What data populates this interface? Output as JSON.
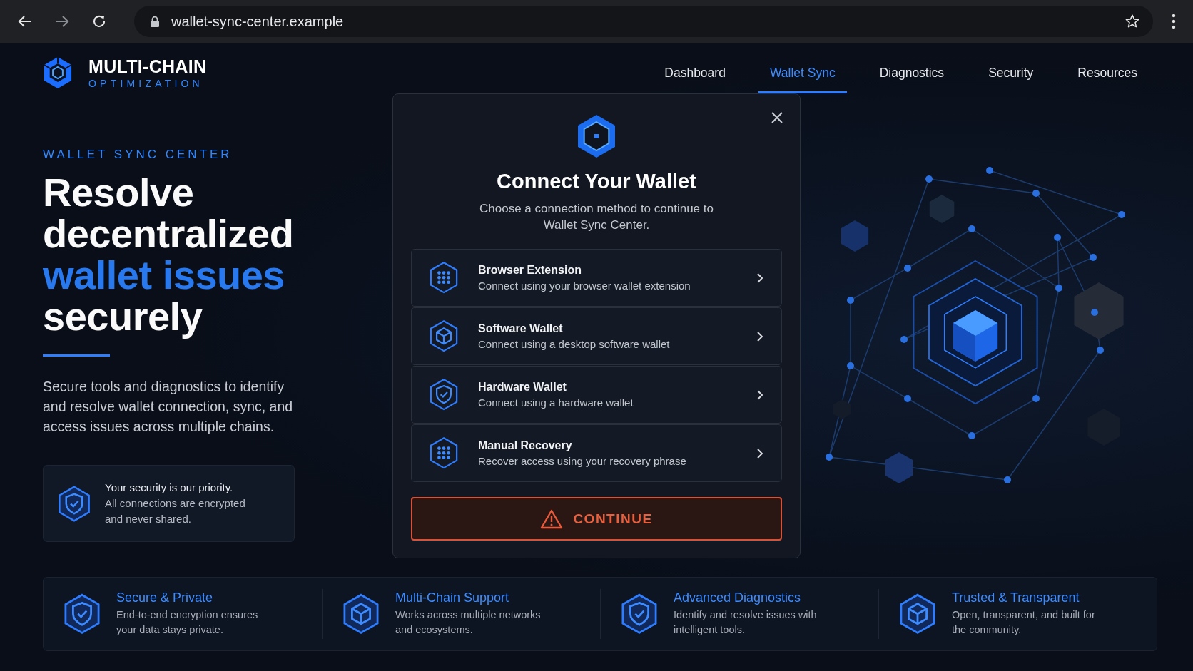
{
  "browser": {
    "url": "wallet-sync-center.example"
  },
  "brand": {
    "name": "MULTI-CHAIN",
    "tagline": "OPTIMIZATION"
  },
  "nav": [
    {
      "label": "Dashboard",
      "selected": false
    },
    {
      "label": "Wallet Sync",
      "selected": true
    },
    {
      "label": "Diagnostics",
      "selected": false
    },
    {
      "label": "Security",
      "selected": false
    },
    {
      "label": "Resources",
      "selected": false
    }
  ],
  "hero": {
    "eyebrow": "WALLET SYNC CENTER",
    "headline_lines": [
      {
        "text": "Resolve",
        "accent": false
      },
      {
        "text": "decentralized",
        "accent": false
      },
      {
        "text": "wallet issues",
        "accent": true
      },
      {
        "text": "securely",
        "accent": false
      }
    ],
    "description": "Secure tools and diagnostics to identify and resolve wallet connection, sync, and access issues across multiple chains.",
    "notice": {
      "title": "Your security is our priority.",
      "text": "All connections are encrypted and never shared."
    }
  },
  "modal": {
    "title": "Connect Your Wallet",
    "subtitle": "Choose a connection method to continue to Wallet Sync Center.",
    "options": [
      {
        "title": "Browser Extension",
        "description": "Connect using your browser wallet extension"
      },
      {
        "title": "Software Wallet",
        "description": "Connect using a desktop software wallet"
      },
      {
        "title": "Hardware Wallet",
        "description": "Connect using a hardware wallet"
      },
      {
        "title": "Manual Recovery",
        "description": "Recover access using your recovery phrase"
      }
    ],
    "button": "CONTINUE"
  },
  "features": [
    {
      "title": "Secure & Private",
      "description": "End-to-end encryption ensures your data stays private."
    },
    {
      "title": "Multi-Chain Support",
      "description": "Works across multiple networks and ecosystems."
    },
    {
      "title": "Advanced Diagnostics",
      "description": "Identify and resolve issues with intelligent tools."
    },
    {
      "title": "Trusted & Transparent",
      "description": "Open, transparent, and built for the community."
    }
  ]
}
